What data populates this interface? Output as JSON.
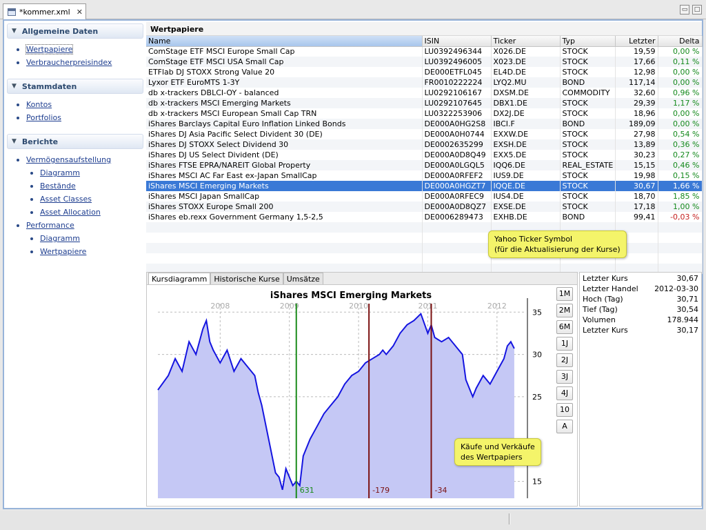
{
  "window": {
    "tab_title": "*kommer.xml",
    "close_symbol": "✕"
  },
  "sidebar": {
    "sections": [
      {
        "title": "Allgemeine Daten",
        "items": [
          {
            "label": "Wertpapiere",
            "level": 1,
            "focused": true
          },
          {
            "label": "Verbraucherpreisindex",
            "level": 1
          }
        ]
      },
      {
        "title": "Stammdaten",
        "items": [
          {
            "label": "Kontos",
            "level": 1
          },
          {
            "label": "Portfolios",
            "level": 1
          }
        ]
      },
      {
        "title": "Berichte",
        "items": [
          {
            "label": "Vermögensaufstellung",
            "level": 1
          },
          {
            "label": "Diagramm",
            "level": 2
          },
          {
            "label": "Bestände",
            "level": 2
          },
          {
            "label": "Asset Classes",
            "level": 2
          },
          {
            "label": "Asset Allocation",
            "level": 2
          },
          {
            "label": "Performance",
            "level": 1
          },
          {
            "label": "Diagramm",
            "level": 2
          },
          {
            "label": "Wertpapiere",
            "level": 2
          }
        ]
      }
    ]
  },
  "securities": {
    "title": "Wertpapiere",
    "columns": [
      "Name",
      "ISIN",
      "Ticker",
      "Typ",
      "Letzter",
      "Delta"
    ],
    "rows": [
      {
        "name": "ComStage ETF MSCI Europe Small Cap",
        "isin": "LU0392496344",
        "ticker": "X026.DE",
        "type": "STOCK",
        "last": "19,59",
        "delta": "0,00 %"
      },
      {
        "name": "ComStage ETF MSCI USA Small Cap",
        "isin": "LU0392496005",
        "ticker": "X023.DE",
        "type": "STOCK",
        "last": "17,66",
        "delta": "0,11 %"
      },
      {
        "name": "ETFlab DJ STOXX Strong Value 20",
        "isin": "DE000ETFL045",
        "ticker": "EL4D.DE",
        "type": "STOCK",
        "last": "12,98",
        "delta": "0,00 %"
      },
      {
        "name": "Lyxor ETF EuroMTS 1-3Y",
        "isin": "FR0010222224",
        "ticker": "LYQ2.MU",
        "type": "BOND",
        "last": "117,14",
        "delta": "0,00 %"
      },
      {
        "name": "db x-trackers DBLCI-OY - balanced",
        "isin": "LU0292106167",
        "ticker": "DXSM.DE",
        "type": "COMMODITY",
        "last": "32,60",
        "delta": "0,96 %"
      },
      {
        "name": "db x-trackers MSCI Emerging Markets",
        "isin": "LU0292107645",
        "ticker": "DBX1.DE",
        "type": "STOCK",
        "last": "29,39",
        "delta": "1,17 %"
      },
      {
        "name": "db x-trackers MSCI European Small Cap TRN",
        "isin": "LU0322253906",
        "ticker": "DX2J.DE",
        "type": "STOCK",
        "last": "18,96",
        "delta": "0,00 %"
      },
      {
        "name": "iShares Barclays Capital Euro Inflation Linked Bonds",
        "isin": "DE000A0HG2S8",
        "ticker": "IBCI.F",
        "type": "BOND",
        "last": "189,09",
        "delta": "0,00 %"
      },
      {
        "name": "iShares DJ Asia Pacific Select Divident 30 (DE)",
        "isin": "DE000A0H0744",
        "ticker": "EXXW.DE",
        "type": "STOCK",
        "last": "27,98",
        "delta": "0,54 %"
      },
      {
        "name": "iShares DJ STOXX Select Dividend 30",
        "isin": "DE0002635299",
        "ticker": "EXSH.DE",
        "type": "STOCK",
        "last": "13,89",
        "delta": "0,36 %"
      },
      {
        "name": "iShares DJ US Select Divident (DE)",
        "isin": "DE000A0D8Q49",
        "ticker": "EXX5.DE",
        "type": "STOCK",
        "last": "30,23",
        "delta": "0,27 %"
      },
      {
        "name": "iShares FTSE EPRA/NAREIT Global Property",
        "isin": "DE000A0LGQL5",
        "ticker": "IQQ6.DE",
        "type": "REAL_ESTATE",
        "last": "15,15",
        "delta": "0,46 %"
      },
      {
        "name": "iShares MSCI AC Far East ex-Japan SmallCap",
        "isin": "DE000A0RFEF2",
        "ticker": "IUS9.DE",
        "type": "STOCK",
        "last": "19,98",
        "delta": "0,15 %"
      },
      {
        "name": "iShares MSCI Emerging Markets",
        "isin": "DE000A0HGZT7",
        "ticker": "IQQE.DE",
        "type": "STOCK",
        "last": "30,67",
        "delta": "1,66 %",
        "selected": true
      },
      {
        "name": "iShares MSCI Japan SmallCap",
        "isin": "DE000A0RFEC9",
        "ticker": "IUS4.DE",
        "type": "STOCK",
        "last": "18,70",
        "delta": "1,85 %"
      },
      {
        "name": "iShares STOXX Europe Small 200",
        "isin": "DE000A0D8QZ7",
        "ticker": "EXSE.DE",
        "type": "STOCK",
        "last": "17,18",
        "delta": "1,00 %"
      },
      {
        "name": "iShares eb.rexx Government Germany 1,5-2,5",
        "isin": "DE0006289473",
        "ticker": "EXHB.DE",
        "type": "BOND",
        "last": "99,41",
        "delta": "-0,03 %"
      }
    ]
  },
  "callouts": {
    "ticker": [
      "Yahoo Ticker Symbol",
      "(für die Aktualisierung der Kurse)"
    ],
    "trades": [
      "Käufe und Verkäufe",
      "des Wertpapiers"
    ]
  },
  "detail_tabs": [
    {
      "label": "Kursdiagramm",
      "active": true
    },
    {
      "label": "Historische Kurse"
    },
    {
      "label": "Umsätze"
    }
  ],
  "zoom_buttons": [
    "1M",
    "2M",
    "6M",
    "1J",
    "2J",
    "3J",
    "4J",
    "10",
    "A"
  ],
  "info": [
    {
      "label": "Letzter Kurs",
      "value": "30,67"
    },
    {
      "label": "Letzter Handel",
      "value": "2012-03-30"
    },
    {
      "label": "Hoch (Tag)",
      "value": "30,71"
    },
    {
      "label": "Tief (Tag)",
      "value": "30,54"
    },
    {
      "label": "Volumen",
      "value": "178.944"
    },
    {
      "label": "Letzter Kurs",
      "value": "30,17"
    }
  ],
  "colors": {
    "selection": "#3a79d6",
    "positive": "#14891c",
    "negative": "#c41e1e",
    "line": "#1414e0",
    "area": "#c5c8f5",
    "buy": "#1a8a1a",
    "sell": "#7a1010"
  },
  "chart_data": {
    "type": "area",
    "title": "iShares MSCI Emerging Markets",
    "xlabel": "",
    "ylabel": "",
    "x_ticks": [
      "2008",
      "2009",
      "2010",
      "2011",
      "2012"
    ],
    "y_ticks": [
      15,
      25,
      30,
      35
    ],
    "ylim": [
      13,
      36
    ],
    "xlim": [
      2007.1,
      2012.4
    ],
    "grid": true,
    "series": [
      {
        "x": [
          2007.1,
          2007.25,
          2007.35,
          2007.45,
          2007.55,
          2007.65,
          2007.75,
          2007.8,
          2007.85,
          2007.9,
          2008.0,
          2008.1,
          2008.2,
          2008.3,
          2008.4,
          2008.5,
          2008.55,
          2008.6,
          2008.7,
          2008.75,
          2008.8,
          2008.85,
          2008.9,
          2008.95,
          2009.0,
          2009.05,
          2009.1,
          2009.15,
          2009.2,
          2009.3,
          2009.4,
          2009.5,
          2009.6,
          2009.7,
          2009.8,
          2009.9,
          2010.0,
          2010.1,
          2010.2,
          2010.3,
          2010.35,
          2010.4,
          2010.5,
          2010.6,
          2010.7,
          2010.8,
          2010.9,
          2011.0,
          2011.05,
          2011.1,
          2011.2,
          2011.3,
          2011.4,
          2011.5,
          2011.55,
          2011.6,
          2011.65,
          2011.7,
          2011.8,
          2011.9,
          2012.0,
          2012.1,
          2012.15,
          2012.2,
          2012.25
        ],
        "values": [
          25.8,
          27.5,
          29.5,
          28.0,
          31.5,
          30.0,
          33.0,
          34.0,
          31.5,
          30.5,
          29.0,
          30.5,
          28.0,
          29.5,
          28.5,
          27.5,
          25.5,
          24.0,
          20.0,
          18.0,
          16.0,
          15.5,
          14.0,
          16.5,
          15.5,
          14.5,
          15.0,
          14.5,
          18.0,
          20.0,
          21.5,
          23.0,
          24.0,
          25.0,
          26.5,
          27.5,
          28.0,
          29.0,
          29.5,
          30.0,
          30.5,
          30.0,
          31.0,
          32.5,
          33.5,
          34.0,
          34.8,
          32.5,
          33.5,
          32.0,
          31.5,
          32.0,
          31.0,
          30.0,
          27.0,
          26.0,
          25.0,
          26.0,
          27.5,
          26.5,
          28.0,
          29.5,
          31.0,
          31.5,
          30.7
        ]
      }
    ],
    "trades": [
      {
        "x": 2009.1,
        "label": "631",
        "kind": "buy"
      },
      {
        "x": 2010.15,
        "label": "-179",
        "kind": "sell"
      },
      {
        "x": 2011.05,
        "label": "-34",
        "kind": "sell"
      }
    ]
  }
}
